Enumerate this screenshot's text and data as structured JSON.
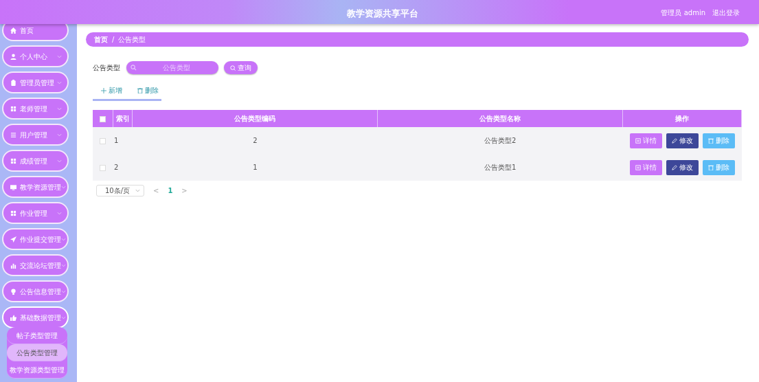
{
  "header": {
    "title": "教学资源共享平台",
    "user": "管理员 admin",
    "logout": "退出登录"
  },
  "sidebar": {
    "items": [
      {
        "label": "首页",
        "expandable": false,
        "expanded": false
      },
      {
        "label": "个人中心",
        "expandable": true,
        "expanded": false
      },
      {
        "label": "管理员管理",
        "expandable": true,
        "expanded": false
      },
      {
        "label": "老师管理",
        "expandable": true,
        "expanded": false
      },
      {
        "label": "用户管理",
        "expandable": true,
        "expanded": false
      },
      {
        "label": "成绩管理",
        "expandable": true,
        "expanded": false
      },
      {
        "label": "教学资源管理",
        "expandable": true,
        "expanded": false
      },
      {
        "label": "作业管理",
        "expandable": true,
        "expanded": false
      },
      {
        "label": "作业提交管理",
        "expandable": true,
        "expanded": false
      },
      {
        "label": "交流论坛管理",
        "expandable": true,
        "expanded": false
      },
      {
        "label": "公告信息管理",
        "expandable": true,
        "expanded": false
      },
      {
        "label": "基础数据管理",
        "expandable": true,
        "expanded": true,
        "children": [
          {
            "label": "帖子类型管理",
            "selected": false
          },
          {
            "label": "公告类型管理",
            "selected": true
          },
          {
            "label": "教学资源类型管理",
            "selected": false
          }
        ]
      }
    ]
  },
  "breadcrumb": [
    "首页",
    "/",
    "公告类型"
  ],
  "search": {
    "label": "公告类型",
    "placeholder": "公告类型",
    "button": "查询"
  },
  "toolbar": [
    "新增",
    "删除"
  ],
  "table": {
    "columns": [
      "索引",
      "公告类型编码",
      "公告类型名称",
      "操作"
    ],
    "header_checked": false,
    "rows": [
      {
        "checked": false,
        "index": "1",
        "code": "2",
        "name": "公告类型2",
        "actions": [
          {
            "kind": "detail",
            "label": "详情"
          },
          {
            "kind": "edit",
            "label": "修改"
          },
          {
            "kind": "delete",
            "label": "删除"
          }
        ]
      },
      {
        "checked": false,
        "index": "2",
        "code": "1",
        "name": "公告类型1",
        "actions": [
          {
            "kind": "detail",
            "label": "详情"
          },
          {
            "kind": "edit",
            "label": "修改"
          },
          {
            "kind": "delete",
            "label": "删除"
          }
        ]
      }
    ]
  },
  "pagination": {
    "page_size": "10条/页",
    "prev": "<",
    "pages": [
      {
        "label": "1",
        "selected": true
      }
    ],
    "next": ">"
  }
}
